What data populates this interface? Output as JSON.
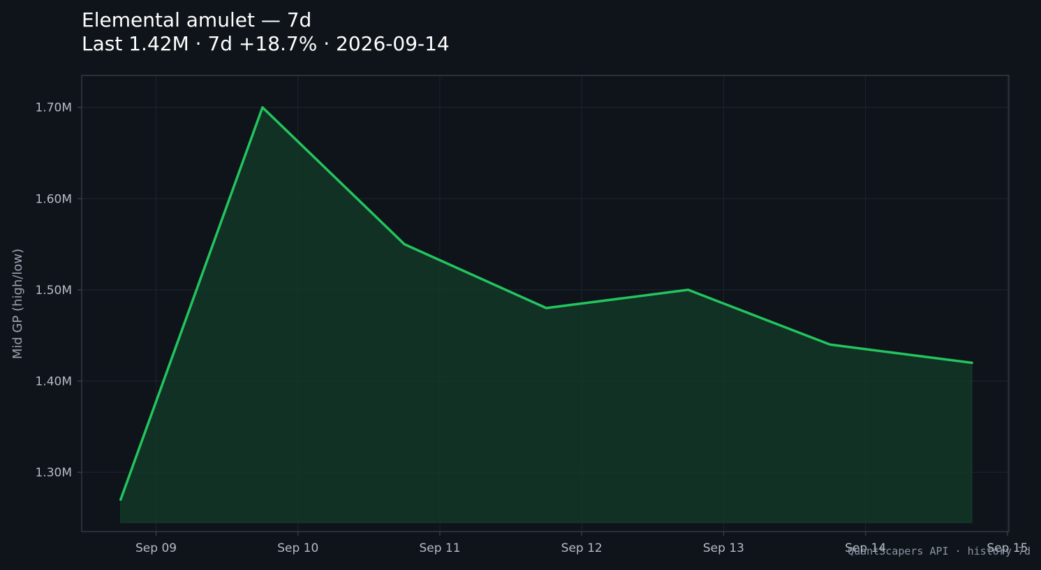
{
  "chart_data": {
    "type": "area",
    "title": "Elemental amulet — 7d",
    "subtitle": "Last 1.42M · 7d +18.7% · 2026-09-14",
    "ylabel": "Mid GP (high/low)",
    "xlabel": "",
    "x": [
      "2026-09-08 18:00",
      "2026-09-09 18:00",
      "2026-09-10 18:00",
      "2026-09-11 18:00",
      "2026-09-12 18:00",
      "2026-09-13 18:00",
      "2026-09-14 18:00"
    ],
    "values": [
      1270000,
      1700000,
      1550000,
      1480000,
      1500000,
      1440000,
      1420000
    ],
    "xticks": [
      {
        "date": "2026-09-09",
        "label": "Sep 09"
      },
      {
        "date": "2026-09-10",
        "label": "Sep 10"
      },
      {
        "date": "2026-09-11",
        "label": "Sep 11"
      },
      {
        "date": "2026-09-12",
        "label": "Sep 12"
      },
      {
        "date": "2026-09-13",
        "label": "Sep 13"
      },
      {
        "date": "2026-09-14",
        "label": "Sep 14"
      },
      {
        "date": "2026-09-15",
        "label": "Sep 15"
      }
    ],
    "yticks": [
      {
        "value": 1300000,
        "label": "1.30M"
      },
      {
        "value": 1400000,
        "label": "1.40M"
      },
      {
        "value": 1500000,
        "label": "1.50M"
      },
      {
        "value": 1600000,
        "label": "1.60M"
      },
      {
        "value": 1700000,
        "label": "1.70M"
      }
    ],
    "xlim": [
      "2026-09-08 11:25",
      "2026-09-15 00:15"
    ],
    "ylim": [
      1235000,
      1735000
    ],
    "fill_baseline": 1245000,
    "grid": true,
    "legend": "none",
    "colors": {
      "background": "#0f141a",
      "line": "#22c55e",
      "fill": "#143b2a",
      "grid": "#1e2630",
      "axis": "#3a434e",
      "tick_text": "#b4bcc6",
      "ylabel": "#9aa3ae"
    }
  },
  "footer": "QuantScapers API · history 7d"
}
